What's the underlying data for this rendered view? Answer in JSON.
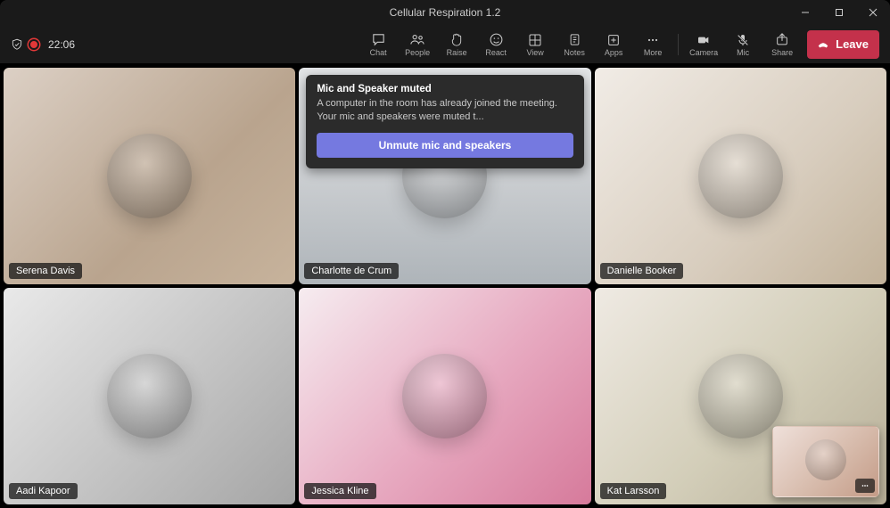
{
  "window": {
    "title": "Cellular Respiration 1.2"
  },
  "status": {
    "recording_time": "22:06"
  },
  "toolbar": {
    "chat": "Chat",
    "people": "People",
    "raise": "Raise",
    "react": "React",
    "view": "View",
    "notes": "Notes",
    "apps": "Apps",
    "more": "More",
    "camera": "Camera",
    "mic": "Mic",
    "share": "Share",
    "leave": "Leave"
  },
  "participants": [
    {
      "name": "Serena Davis"
    },
    {
      "name": "Charlotte de Crum"
    },
    {
      "name": "Danielle Booker"
    },
    {
      "name": "Aadi Kapoor"
    },
    {
      "name": "Jessica Kline"
    },
    {
      "name": "Kat Larsson"
    }
  ],
  "toast": {
    "title": "Mic and Speaker muted",
    "body": "A computer in the room has already joined the meeting. Your mic and speakers were muted t...",
    "button_label": "Unmute mic and speakers"
  }
}
